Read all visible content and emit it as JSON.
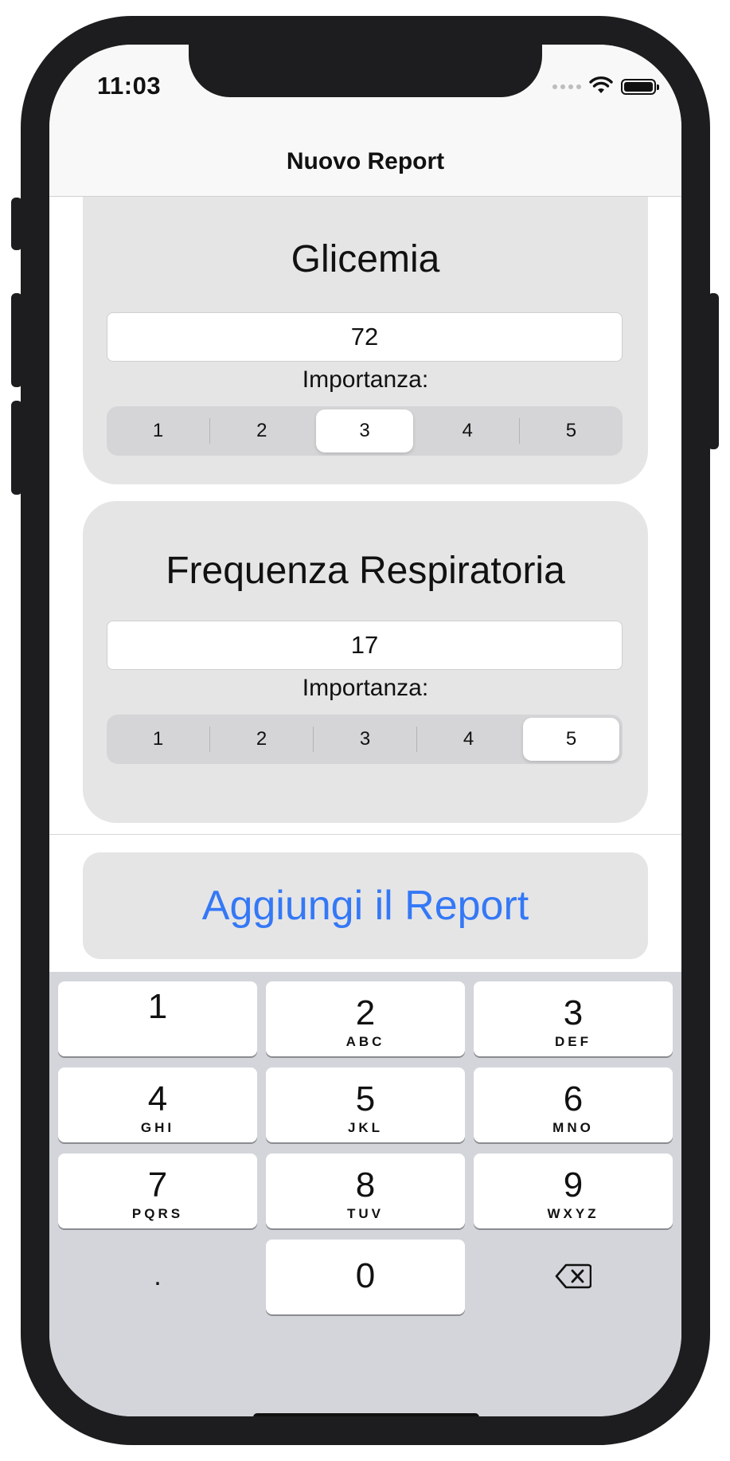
{
  "status_bar": {
    "time": "11:03",
    "icons": [
      "wifi-icon",
      "battery-icon"
    ]
  },
  "nav": {
    "title": "Nuovo Report"
  },
  "cards": [
    {
      "title": "Glicemia",
      "value": "72",
      "importance_label": "Importanza:",
      "segments": [
        "1",
        "2",
        "3",
        "4",
        "5"
      ],
      "selected": "3"
    },
    {
      "title": "Frequenza Respiratoria",
      "value": "17",
      "importance_label": "Importanza:",
      "segments": [
        "1",
        "2",
        "3",
        "4",
        "5"
      ],
      "selected": "5"
    }
  ],
  "add_button": {
    "label": "Aggiungi il Report",
    "color": "#3478f6"
  },
  "keyboard": {
    "keys": [
      {
        "digit": "1",
        "letters": ""
      },
      {
        "digit": "2",
        "letters": "ABC"
      },
      {
        "digit": "3",
        "letters": "DEF"
      },
      {
        "digit": "4",
        "letters": "GHI"
      },
      {
        "digit": "5",
        "letters": "JKL"
      },
      {
        "digit": "6",
        "letters": "MNO"
      },
      {
        "digit": "7",
        "letters": "PQRS"
      },
      {
        "digit": "8",
        "letters": "TUV"
      },
      {
        "digit": "9",
        "letters": "WXYZ"
      },
      {
        "digit": ".",
        "letters": ""
      },
      {
        "digit": "0",
        "letters": ""
      }
    ],
    "delete_icon": "backspace-icon"
  }
}
